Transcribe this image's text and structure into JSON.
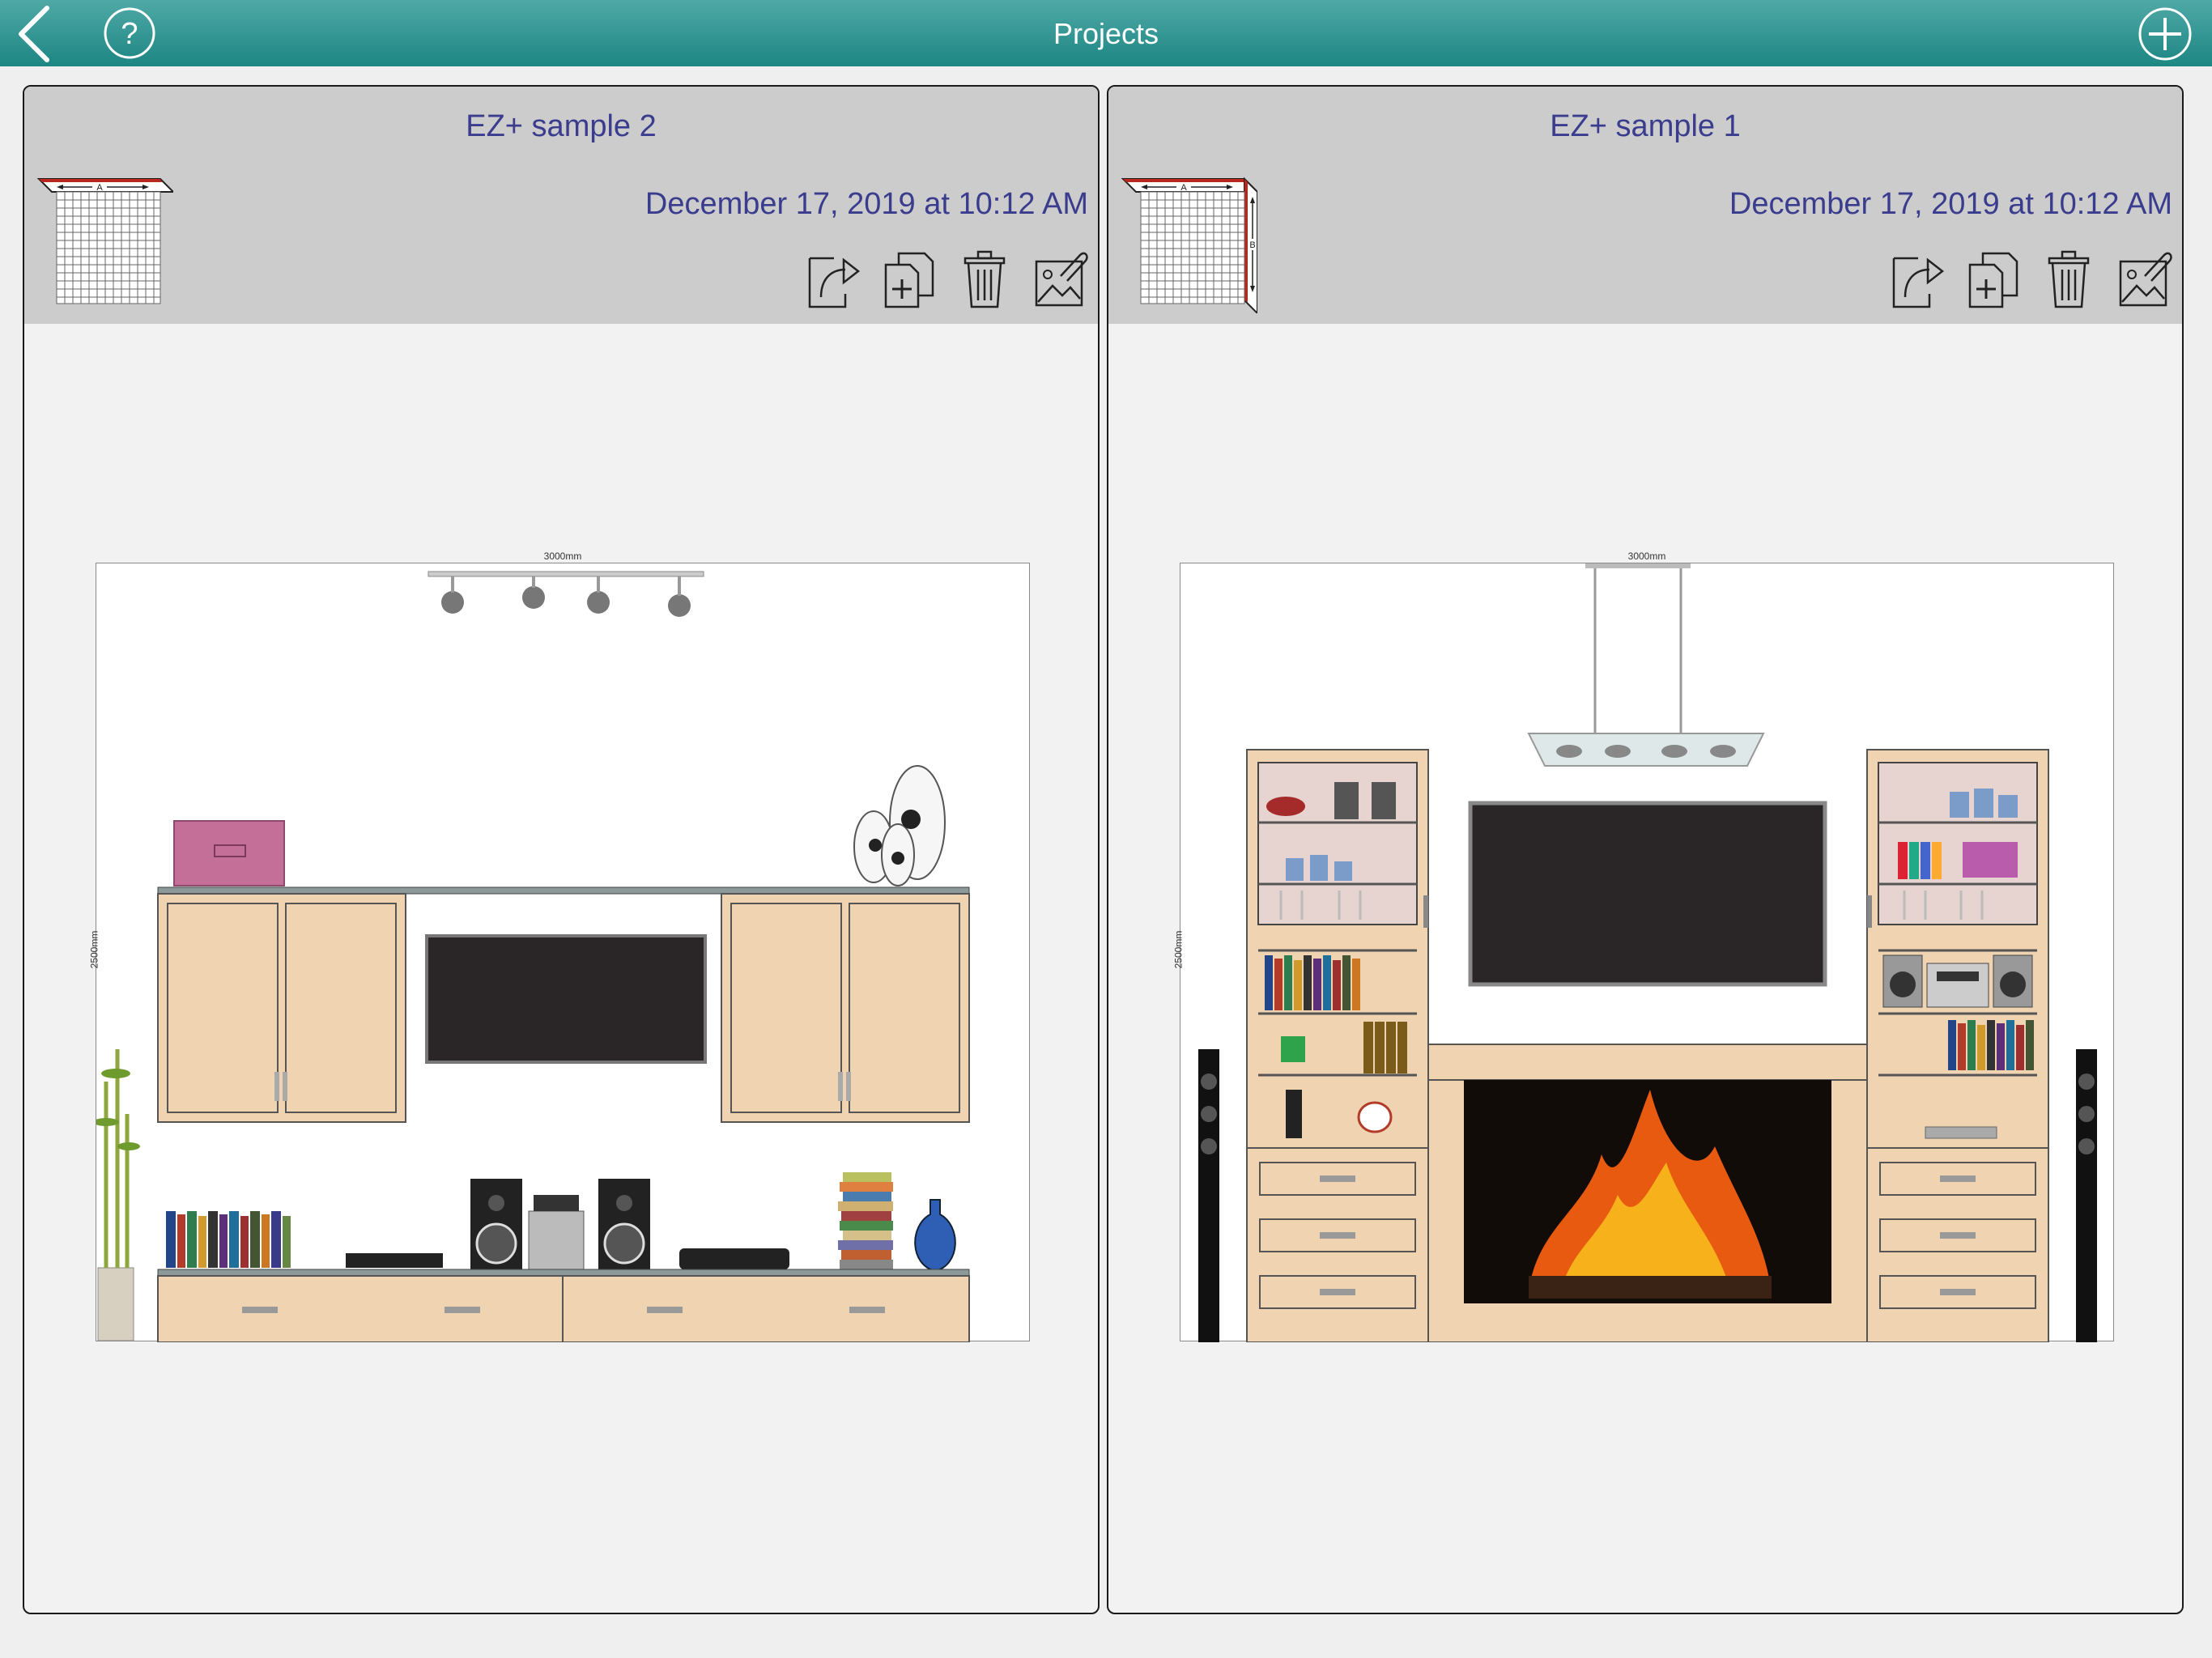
{
  "header": {
    "title": "Projects",
    "back_icon": "back-chevron-icon",
    "help_icon": "help-question-icon",
    "add_icon": "add-plus-icon"
  },
  "projects": [
    {
      "name": "EZ+ sample 2",
      "date": "December 17, 2019 at 10:12 AM",
      "thumbnail_icon": "single-wall-A-thumbnail",
      "thumb_labels": [
        "A"
      ],
      "actions": [
        "share-icon",
        "duplicate-icon",
        "trash-icon",
        "image-attach-icon"
      ],
      "width_label": "3000mm",
      "height_label": "2500mm"
    },
    {
      "name": "EZ+ sample 1",
      "date": "December 17, 2019 at 10:12 AM",
      "thumbnail_icon": "corner-wall-AB-thumbnail",
      "thumb_labels": [
        "A",
        "B"
      ],
      "actions": [
        "share-icon",
        "duplicate-icon",
        "trash-icon",
        "image-attach-icon"
      ],
      "width_label": "3000mm",
      "height_label": "2500mm"
    }
  ],
  "colors": {
    "topbar": "#1d8683",
    "title_text": "#3a3c8e",
    "cabinet_wood": "#f0d4b2",
    "tv_screen": "#2a2627"
  }
}
